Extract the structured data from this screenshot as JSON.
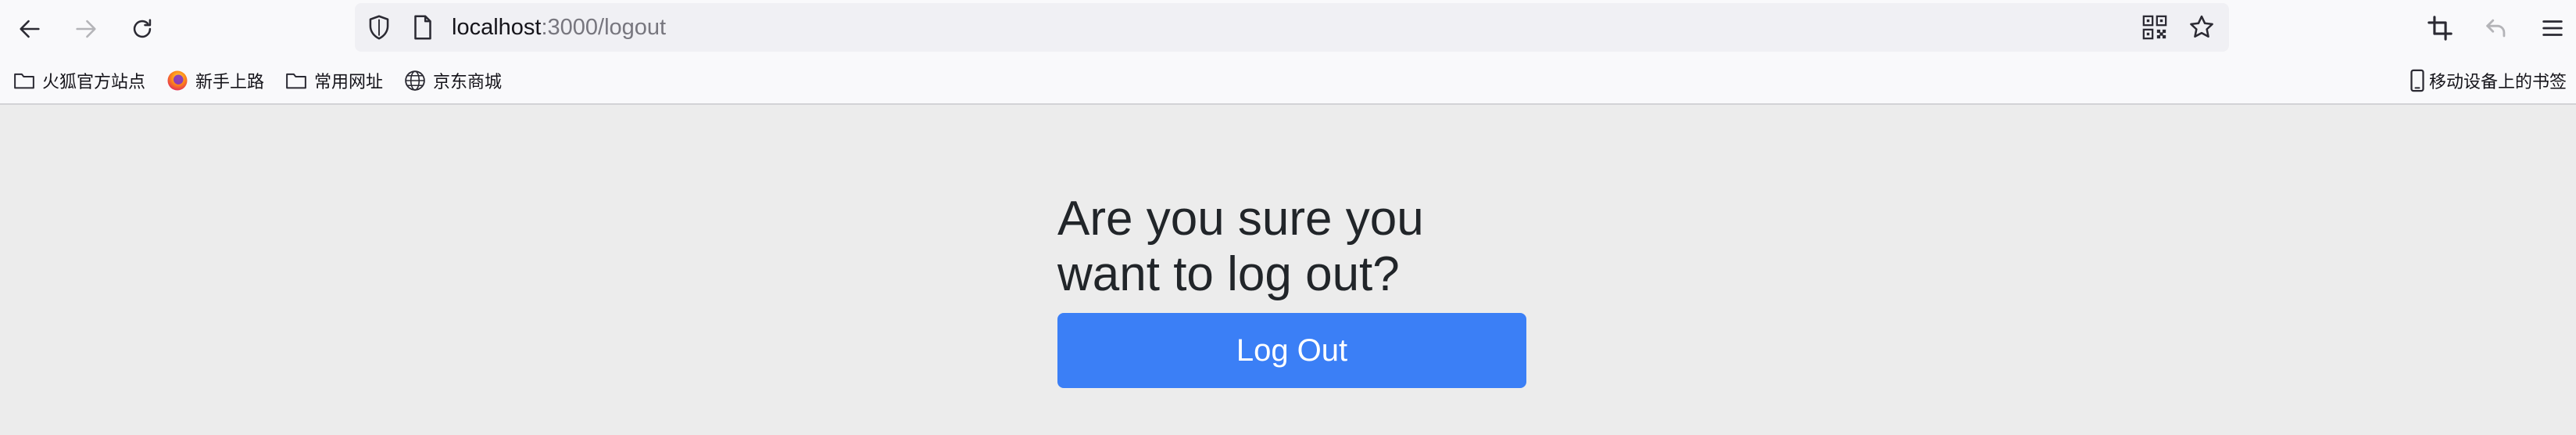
{
  "browser": {
    "url_host": "localhost",
    "url_path": ":3000/logout"
  },
  "bookmarks": {
    "left_items": [
      {
        "label": "火狐官方站点",
        "icon": "folder-icon"
      },
      {
        "label": "新手上路",
        "icon": "firefox-icon"
      },
      {
        "label": "常用网址",
        "icon": "folder-icon"
      },
      {
        "label": "京东商城",
        "icon": "globe-icon"
      }
    ],
    "mobile": {
      "label": "移动设备上的书签",
      "icon": "mobile-icon"
    }
  },
  "page": {
    "title": "Are you sure you want to log out?",
    "button_label": "Log Out",
    "button_color": "#3b7ff6"
  }
}
